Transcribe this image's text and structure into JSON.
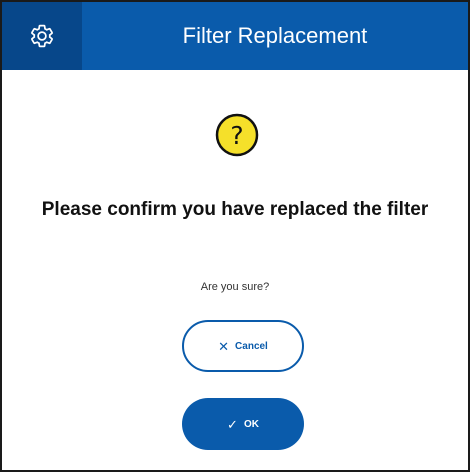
{
  "header": {
    "title": "Filter Replacement",
    "settings_icon": "gear-icon"
  },
  "dialog": {
    "icon": "question-icon",
    "message": "Please confirm you have replaced the filter",
    "subtext": "Are you sure?"
  },
  "buttons": {
    "cancel": {
      "icon": "✕",
      "label": "Cancel"
    },
    "ok": {
      "icon": "✓",
      "label": "OK"
    }
  },
  "colors": {
    "header": "#0a5bab",
    "settings_bg": "#07478a",
    "warning_yellow": "#f5e02a",
    "button_blue": "#0a5bab"
  }
}
